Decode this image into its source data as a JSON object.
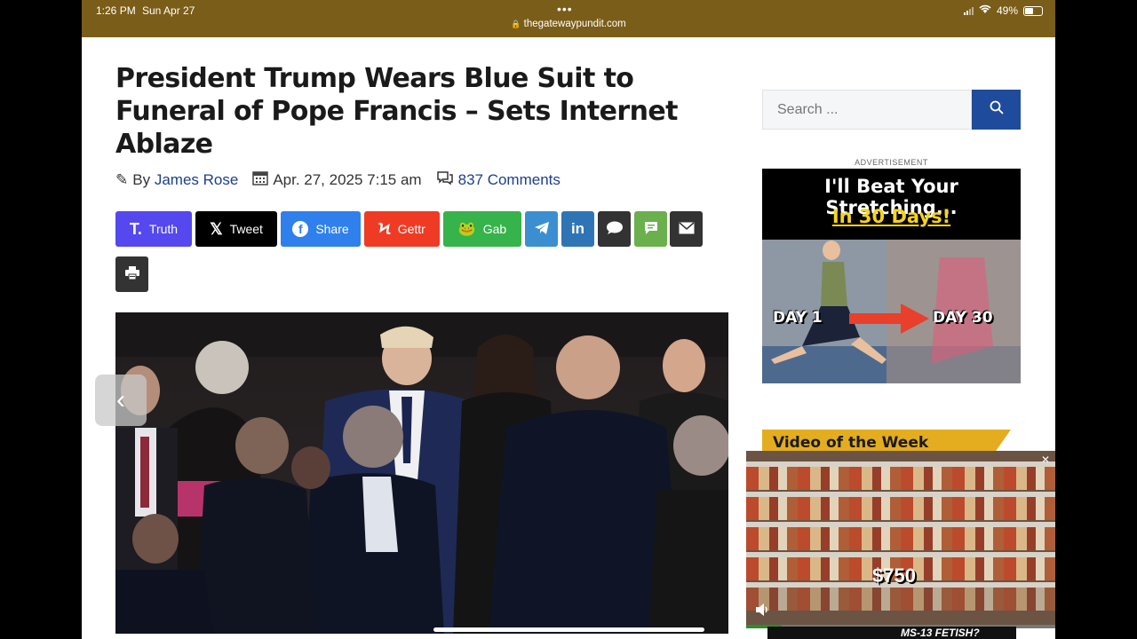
{
  "status_bar": {
    "time": "1:26 PM",
    "date": "Sun Apr 27",
    "url": "thegatewaypundit.com",
    "battery": "49%",
    "bg_color": "#7a5d18"
  },
  "article": {
    "title": "President Trump Wears Blue Suit to Funeral of Pope Francis – Sets Internet Ablaze",
    "by_label": "By",
    "author": "James Rose",
    "date": "Apr. 27, 2025 7:15 am",
    "comments": "837 Comments",
    "link_color": "#1c3f8f"
  },
  "share_buttons": [
    {
      "label": "Truth",
      "icon": "truth-social-icon",
      "color": "#5448ee"
    },
    {
      "label": "Tweet",
      "icon": "x-icon",
      "color": "#000000"
    },
    {
      "label": "Share",
      "icon": "facebook-icon",
      "color": "#2f80ed"
    },
    {
      "label": "Gettr",
      "icon": "gettr-icon",
      "color": "#ef3b24"
    },
    {
      "label": "Gab",
      "icon": "gab-icon",
      "color": "#36b34a"
    },
    {
      "label": "",
      "icon": "telegram-icon",
      "color": "#3b8fd1"
    },
    {
      "label": "",
      "icon": "linkedin-icon",
      "color": "#2f75b5"
    },
    {
      "label": "",
      "icon": "speech-bubble-icon",
      "color": "#333333"
    },
    {
      "label": "",
      "icon": "sms-icon",
      "color": "#6ab04c"
    },
    {
      "label": "",
      "icon": "email-icon",
      "color": "#333333"
    },
    {
      "label": "",
      "icon": "print-icon",
      "color": "#333333"
    }
  ],
  "sidebar": {
    "search_placeholder": "Search ...",
    "search_button_color": "#1f4b9c",
    "ad_label": "ADVERTISEMENT",
    "ad_headline": "I'll Beat Your Stretching...",
    "ad_subheadline": "In 30 Days!",
    "ad_day_start": "DAY 1",
    "ad_day_end": "DAY 30",
    "video_heading": "Video of the Week",
    "video_price": "$750",
    "next_item": "MS-13 FETISH?"
  }
}
